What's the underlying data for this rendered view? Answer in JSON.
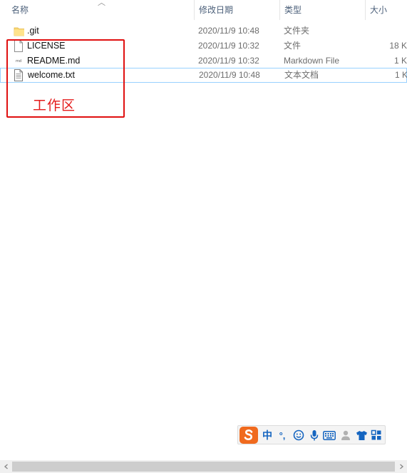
{
  "columns": {
    "name": "名称",
    "date": "修改日期",
    "type": "类型",
    "size": "大小"
  },
  "files": [
    {
      "name": ".git",
      "date": "2020/11/9 10:48",
      "type": "文件夹",
      "size": "",
      "icon": "folder-icon"
    },
    {
      "name": "LICENSE",
      "date": "2020/11/9 10:32",
      "type": "文件",
      "size": "18 K",
      "icon": "file-icon"
    },
    {
      "name": "README.md",
      "date": "2020/11/9 10:32",
      "type": "Markdown File",
      "size": "1 K",
      "icon": "markdown-file-icon"
    },
    {
      "name": "welcome.txt",
      "date": "2020/11/9 10:48",
      "type": "文本文档",
      "size": "1 K",
      "icon": "text-file-icon"
    }
  ],
  "annotation": {
    "label": "工作区",
    "color": "#e01010"
  },
  "ime_toolbar": {
    "mode_label": "中",
    "punct_label": "°,",
    "icons": [
      "sogou-logo-icon",
      "emoji-icon",
      "microphone-icon",
      "keyboard-icon",
      "user-icon",
      "skin-shirt-icon",
      "toolbox-icon"
    ]
  },
  "colors": {
    "header_text": "#4c607a",
    "selection_border": "#99d1ff",
    "ime_blue": "#1565c0",
    "ime_logo": "#f06a1e"
  }
}
